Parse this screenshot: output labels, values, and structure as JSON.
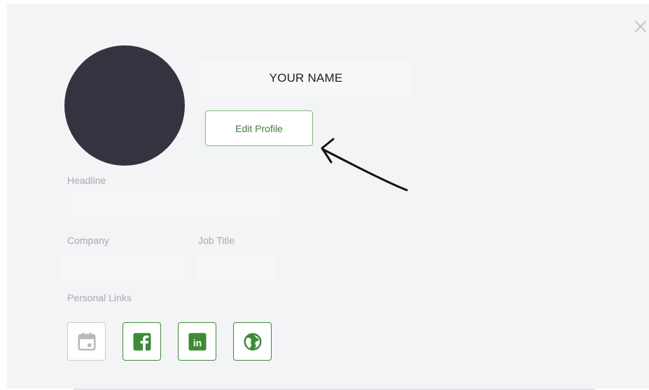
{
  "profile": {
    "name": "YOUR NAME",
    "edit_button_label": "Edit Profile"
  },
  "fields": {
    "headline_label": "Headline",
    "company_label": "Company",
    "job_title_label": "Job Title",
    "personal_links_label": "Personal Links"
  },
  "links": [
    {
      "icon": "calendar-icon",
      "state": "disabled"
    },
    {
      "icon": "facebook-icon",
      "state": "active"
    },
    {
      "icon": "linkedin-icon",
      "state": "active",
      "glyph": "in"
    },
    {
      "icon": "globe-icon",
      "state": "active"
    }
  ],
  "colors": {
    "accent_green": "#3e8a37",
    "button_border": "#7fb87a",
    "avatar": "#343440",
    "background": "#f3f4f6",
    "label_gray": "#a7a9ad"
  },
  "annotation": {
    "type": "hand-drawn arrow pointing to Edit Profile button"
  }
}
